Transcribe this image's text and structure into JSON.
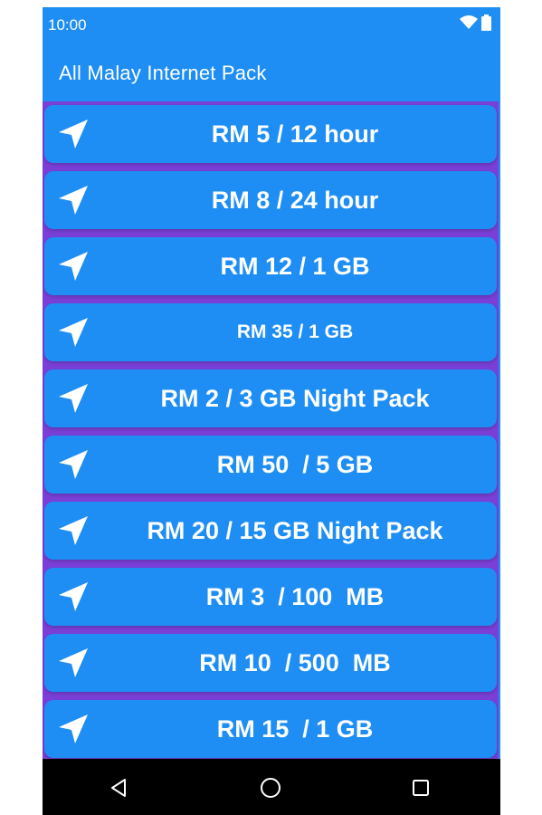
{
  "status_bar": {
    "time": "10:00",
    "icons": [
      "wifi-icon",
      "battery-icon"
    ]
  },
  "app_bar": {
    "title": "All Malay Internet Pack"
  },
  "colors": {
    "primary": "#1e8ef4",
    "divider": "#7a3fd6",
    "nav_bar": "#000000"
  },
  "packs": [
    {
      "label": "RM 5 / 12 hour",
      "icon": "navigation-arrow-icon"
    },
    {
      "label": "RM 8 / 24 hour",
      "icon": "navigation-arrow-icon"
    },
    {
      "label": "RM 12 / 1 GB",
      "icon": "navigation-arrow-icon"
    },
    {
      "label": "RM 35 / 1 GB",
      "icon": "navigation-arrow-icon"
    },
    {
      "label": "RM 2 / 3 GB Night Pack",
      "icon": "navigation-arrow-icon"
    },
    {
      "label": "RM 50  / 5 GB",
      "icon": "navigation-arrow-icon"
    },
    {
      "label": "RM 20 / 15 GB Night Pack",
      "icon": "navigation-arrow-icon"
    },
    {
      "label": "RM 3  / 100  MB",
      "icon": "navigation-arrow-icon"
    },
    {
      "label": "RM 10  / 500  MB",
      "icon": "navigation-arrow-icon"
    },
    {
      "label": "RM 15  / 1 GB",
      "icon": "navigation-arrow-icon"
    }
  ],
  "nav_bar": {
    "buttons": [
      "back-icon",
      "home-icon",
      "recents-icon"
    ]
  }
}
